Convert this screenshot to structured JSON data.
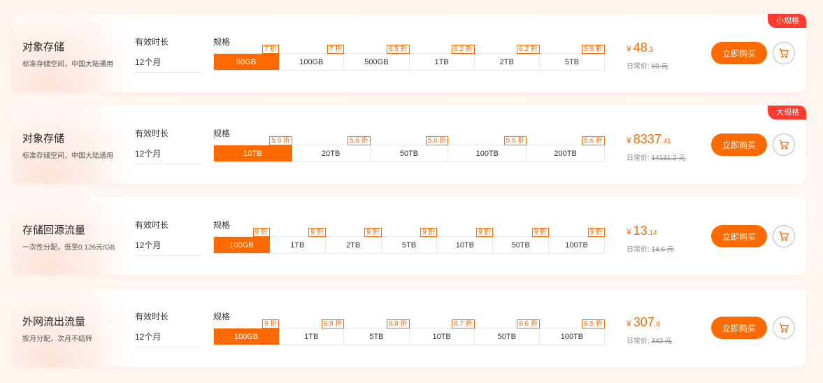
{
  "colors": {
    "accent": "#ff6a00",
    "tag_red": "#ff3b30"
  },
  "cards": [
    {
      "title": "对象存储",
      "subtitle": "标准存储空间，中国大陆通用",
      "duration_label": "有效时长",
      "duration_value": "12个月",
      "spec_label": "规格",
      "options": [
        {
          "label": "50GB",
          "discount": "7 折",
          "active": true
        },
        {
          "label": "100GB",
          "discount": "7 折"
        },
        {
          "label": "500GB",
          "discount": "6.5 折"
        },
        {
          "label": "1TB",
          "discount": "6.2 折"
        },
        {
          "label": "2TB",
          "discount": "6.2 折"
        },
        {
          "label": "5TB",
          "discount": "5.9 折"
        }
      ],
      "price_symbol": "¥",
      "price_int": "48",
      "price_dec": ".3",
      "orig_label": "日常价:",
      "orig_price": "69 元",
      "buy_label": "立即购买",
      "tag": "小规格"
    },
    {
      "title": "对象存储",
      "subtitle": "标准存储空间，中国大陆通用",
      "duration_label": "有效时长",
      "duration_value": "12个月",
      "spec_label": "规格",
      "options": [
        {
          "label": "10TB",
          "discount": "5.9 折",
          "active": true
        },
        {
          "label": "20TB",
          "discount": "5.6 折"
        },
        {
          "label": "50TB",
          "discount": "5.6 折"
        },
        {
          "label": "100TB",
          "discount": "5.6 折"
        },
        {
          "label": "200TB",
          "discount": "5.6 折"
        }
      ],
      "price_symbol": "¥",
      "price_int": "8337",
      "price_dec": ".41",
      "orig_label": "日常价:",
      "orig_price": "14131.2 元",
      "buy_label": "立即购买",
      "tag": "大规格"
    },
    {
      "title": "存储回源流量",
      "subtitle": "一次性分配，低至0.126元/GB",
      "duration_label": "有效时长",
      "duration_value": "12个月",
      "spec_label": "规格",
      "options": [
        {
          "label": "100GB",
          "discount": "9 折",
          "active": true
        },
        {
          "label": "1TB",
          "discount": "9 折"
        },
        {
          "label": "2TB",
          "discount": "9 折"
        },
        {
          "label": "5TB",
          "discount": "9 折"
        },
        {
          "label": "10TB",
          "discount": "9 折"
        },
        {
          "label": "50TB",
          "discount": "9 折"
        },
        {
          "label": "100TB",
          "discount": "9 折"
        }
      ],
      "price_symbol": "¥",
      "price_int": "13",
      "price_dec": ".14",
      "orig_label": "日常价:",
      "orig_price": "14.6 元",
      "buy_label": "立即购买",
      "tag": ""
    },
    {
      "title": "外网流出流量",
      "subtitle": "按月分配，次月不结转",
      "duration_label": "有效时长",
      "duration_value": "12个月",
      "spec_label": "规格",
      "options": [
        {
          "label": "100GB",
          "discount": "9 折",
          "active": true
        },
        {
          "label": "1TB",
          "discount": "8.9 折"
        },
        {
          "label": "5TB",
          "discount": "8.8 折"
        },
        {
          "label": "10TB",
          "discount": "8.7 折"
        },
        {
          "label": "50TB",
          "discount": "8.6 折"
        },
        {
          "label": "100TB",
          "discount": "8.5 折"
        }
      ],
      "price_symbol": "¥",
      "price_int": "307",
      "price_dec": ".8",
      "orig_label": "日常价:",
      "orig_price": "342 元",
      "buy_label": "立即购买",
      "tag": ""
    }
  ]
}
